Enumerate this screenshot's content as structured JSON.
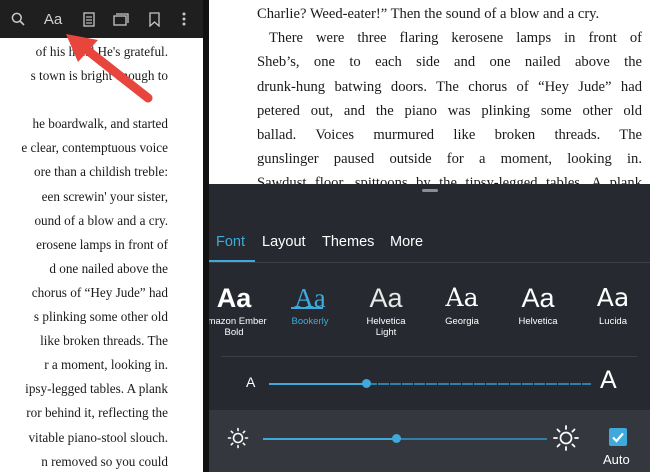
{
  "toolbar": {
    "aa_label": "Aa",
    "icons": [
      "search-icon",
      "font-settings-icon",
      "notes-icon",
      "page-flip-icon",
      "bookmark-icon",
      "more-icon"
    ]
  },
  "left_page": {
    "lines": [
      "of his h[er] He's grateful.",
      "s town is bright enough to",
      "",
      "he boardwalk, and started",
      "e clear, contemptuous voice",
      "ore than a childish treble:",
      "een screwin' your sister,",
      "ound of a blow and a cry.",
      "erosene lamps in front of",
      "d one nailed above the",
      "chorus of “Hey Jude” had",
      "s plinking some other old",
      "like broken threads. The",
      "r a moment, looking in.",
      "ipsy-legged tables. A plank",
      "ror behind it, reflecting the",
      "vitable piano-stool slouch.",
      "n removed so you could"
    ]
  },
  "right_page": {
    "lines": [
      "Charlie? Weed-eater!” Then the sound of a blow and a cry.",
      "There were three flaring kerosene lamps in front of",
      "Sheb’s, one to each side and one nailed above the",
      "drunk-hung batwing doors. The chorus of “Hey Jude” had",
      "petered out, and the piano was plinking some other old",
      "ballad. Voices murmured like broken threads. The",
      "gunslinger paused outside for a moment, looking in.",
      "Sawdust floor, spittoons by the tipsy-legged tables. A plank"
    ]
  },
  "settings": {
    "tabs": [
      {
        "label": "Font",
        "active": true
      },
      {
        "label": "Layout",
        "active": false
      },
      {
        "label": "Themes",
        "active": false
      },
      {
        "label": "More",
        "active": false
      }
    ],
    "fonts": [
      {
        "sample": "Aa",
        "name": "Amazon Ember Bold",
        "selected": false
      },
      {
        "sample": "Aa",
        "name": "Bookerly",
        "selected": true
      },
      {
        "sample": "Aa",
        "name": "Helvetica Light",
        "selected": false
      },
      {
        "sample": "Aa",
        "name": "Georgia",
        "selected": false
      },
      {
        "sample": "Aa",
        "name": "Helvetica",
        "selected": false
      },
      {
        "sample": "Aa",
        "name": "Lucida",
        "selected": false
      }
    ],
    "font_size": {
      "small_label": "A",
      "large_label": "A",
      "level": 0.3
    },
    "brightness": {
      "level": 0.47,
      "auto_label": "Auto",
      "auto_checked": true
    },
    "accent_color": "#3fa9dc",
    "panel_color": "#262a30"
  }
}
